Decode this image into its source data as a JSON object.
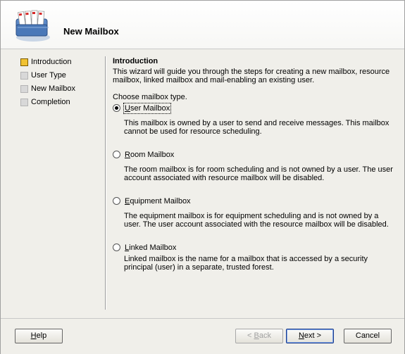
{
  "header": {
    "title": "New Mailbox"
  },
  "nav": {
    "items": [
      {
        "label": "Introduction",
        "active": true
      },
      {
        "label": "User Type",
        "active": false
      },
      {
        "label": "New Mailbox",
        "active": false
      },
      {
        "label": "Completion",
        "active": false
      }
    ]
  },
  "content": {
    "section_title": "Introduction",
    "intro": "This wizard will guide you through the steps for creating a new mailbox, resource mailbox, linked mailbox and mail-enabling an existing user.",
    "choose_label": "Choose mailbox type.",
    "options": [
      {
        "access_key": "U",
        "label_rest": "ser Mailbox",
        "checked": true,
        "description": "This mailbox is owned by a user to send and receive messages. This mailbox cannot be used for resource scheduling."
      },
      {
        "access_key": "R",
        "label_rest": "oom Mailbox",
        "checked": false,
        "description": "The room mailbox is for room scheduling and is not owned by a user. The user account associated with resource mailbox will be disabled."
      },
      {
        "access_key": "E",
        "label_rest": "quipment Mailbox",
        "checked": false,
        "description": "The equipment mailbox is for equipment scheduling and is not owned by a user. The user account associated with the resource mailbox will be disabled."
      },
      {
        "access_key": "L",
        "label_rest": "inked Mailbox",
        "checked": false,
        "description": "Linked mailbox is the name for a mailbox that is accessed by a security principal (user) in a separate, trusted forest."
      }
    ]
  },
  "footer": {
    "help": {
      "key": "H",
      "rest": "elp"
    },
    "back": {
      "prefix": "< ",
      "key": "B",
      "rest": "ack"
    },
    "next": {
      "key": "N",
      "rest": "ext >"
    },
    "cancel": "Cancel"
  },
  "colors": {
    "active_nav": "#f1c232",
    "inactive_nav": "#d8d8d8",
    "background": "#f0efea"
  }
}
